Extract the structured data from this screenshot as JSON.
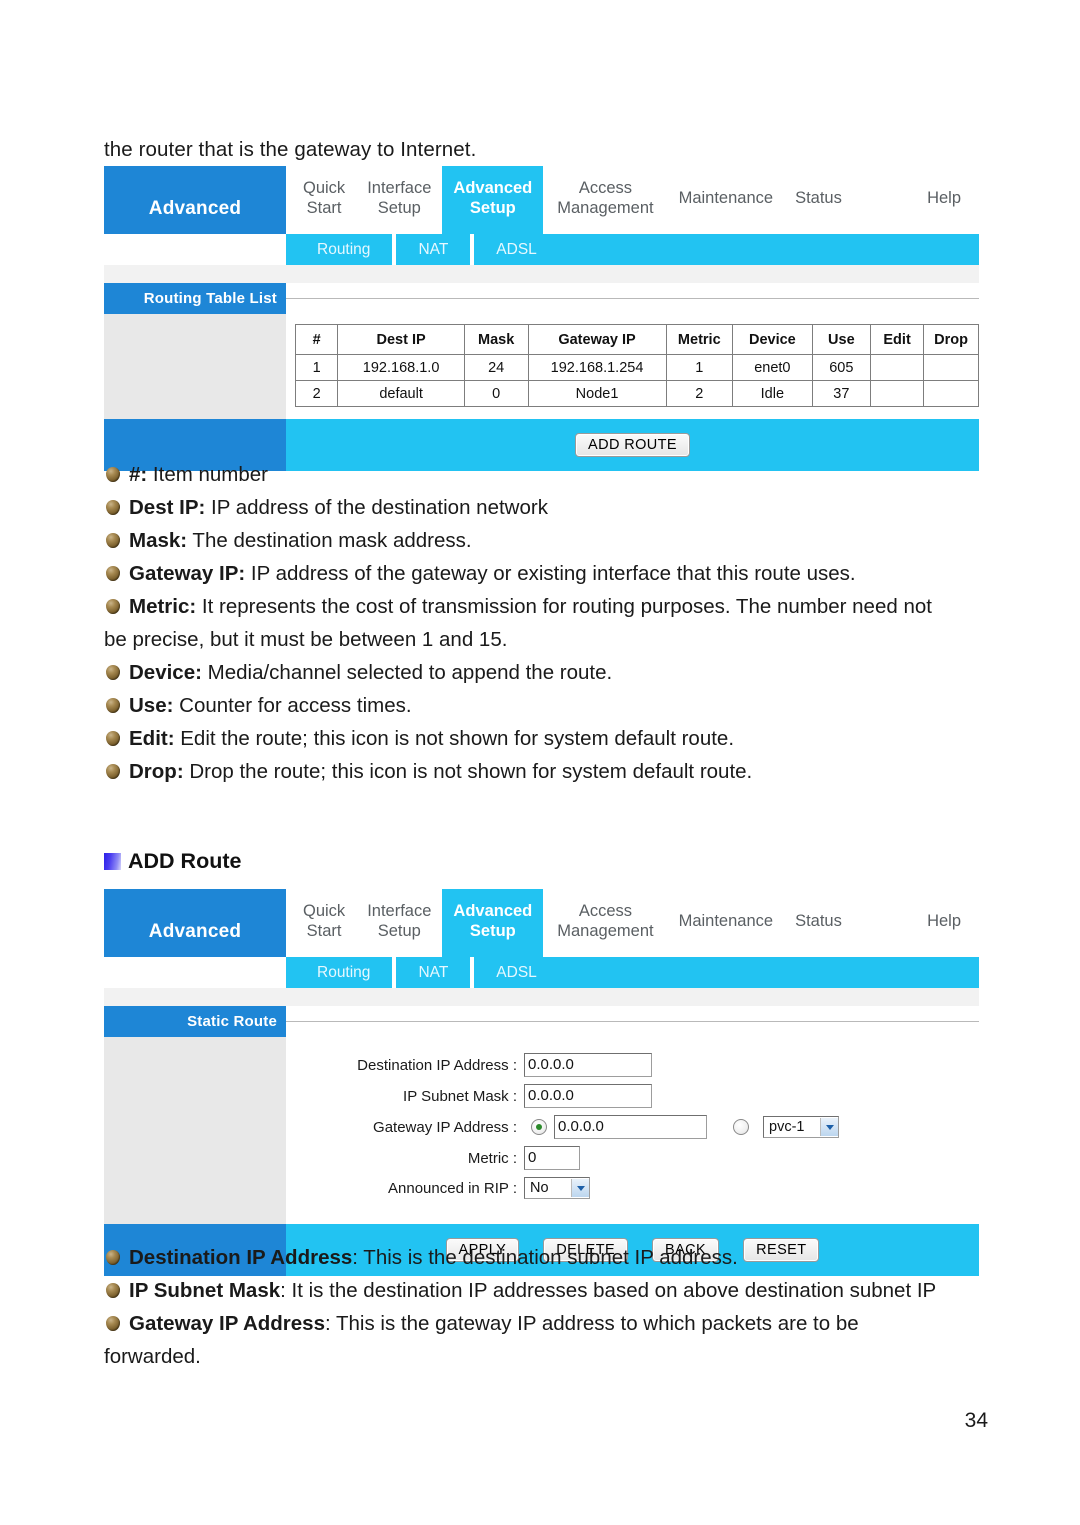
{
  "document": {
    "intro_text": "the router that is the gateway to Internet.",
    "page_number": "34"
  },
  "router_nav": {
    "brand": "Advanced",
    "tabs": [
      {
        "line1": "Quick",
        "line2": "Start"
      },
      {
        "line1": "Interface",
        "line2": "Setup"
      },
      {
        "line1": "Advanced",
        "line2": "Setup"
      },
      {
        "line1": "Access",
        "line2": "Management"
      },
      {
        "line1": "Maintenance",
        "line2": ""
      },
      {
        "line1": "Status",
        "line2": ""
      },
      {
        "line1": "Help",
        "line2": ""
      }
    ],
    "active_tab": "Advanced Setup",
    "subtabs": [
      "Routing",
      "NAT",
      "ADSL"
    ],
    "active_subtab": "Routing"
  },
  "routing_panel": {
    "side_title": "Routing Table List",
    "table": {
      "headers": [
        "#",
        "Dest IP",
        "Mask",
        "Gateway IP",
        "Metric",
        "Device",
        "Use",
        "Edit",
        "Drop"
      ],
      "rows": [
        [
          "1",
          "192.168.1.0",
          "24",
          "192.168.1.254",
          "1",
          "enet0",
          "605",
          "",
          ""
        ],
        [
          "2",
          "default",
          "0",
          "Node1",
          "2",
          "Idle",
          "37",
          "",
          ""
        ]
      ]
    },
    "add_route_button": "ADD ROUTE"
  },
  "field_descriptions": [
    {
      "term": "#:",
      "desc": " Item number"
    },
    {
      "term": "Dest IP:",
      "desc": " IP address of the destination network"
    },
    {
      "term": "Mask:",
      "desc": " The destination mask address."
    },
    {
      "term": "Gateway IP:",
      "desc": " IP address of the gateway or existing interface that this route uses."
    },
    {
      "term": "Metric:",
      "desc": " It represents the cost of transmission for routing purposes. The number need not"
    },
    {
      "term": "",
      "desc": "be precise, but it must be between 1 and 15."
    },
    {
      "term": "Device:",
      "desc": " Media/channel selected to append the route."
    },
    {
      "term": "Use:",
      "desc": " Counter for access times."
    },
    {
      "term": "Edit:",
      "desc": " Edit the route; this icon is not shown for system default route."
    },
    {
      "term": "Drop:",
      "desc": " Drop the route; this icon is not shown for system default route."
    }
  ],
  "add_route_heading": "ADD Route",
  "static_route_panel": {
    "side_title": "Static Route",
    "fields": {
      "destination_ip_label": "Destination IP Address :",
      "destination_ip_value": "0.0.0.0",
      "subnet_mask_label": "IP Subnet Mask :",
      "subnet_mask_value": "0.0.0.0",
      "gateway_label": "Gateway IP Address :",
      "gateway_value": "0.0.0.0",
      "gateway_pvc_value": "pvc-1",
      "metric_label": "Metric :",
      "metric_value": "0",
      "rip_label": "Announced in RIP :",
      "rip_value": "No"
    },
    "buttons": [
      "APPLY",
      "DELETE",
      "BACK",
      "RESET"
    ]
  },
  "add_route_descriptions": [
    {
      "term": "Destination IP Address",
      "desc": ":   This is the destination subnet IP address."
    },
    {
      "term": "IP Subnet Mask",
      "desc": ":   It is the destination IP addresses based on above destination subnet IP"
    },
    {
      "term": "Gateway IP Address",
      "desc": ":   This is the gateway IP address to which packets are to be"
    },
    {
      "term": "",
      "desc": "forwarded."
    }
  ],
  "colors": {
    "brand_blue": "#1e86d6",
    "cyan": "#22c3f2",
    "side_gray": "#e8e8e8",
    "bullet_brown": "#7a5f2c"
  }
}
